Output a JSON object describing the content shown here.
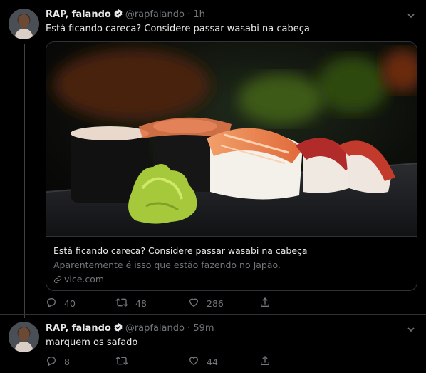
{
  "tweet1": {
    "name": "RAP, falando",
    "handle": "@rapfalando",
    "separator": "·",
    "time": "1h",
    "text": "Está ficando careca? Considere passar wasabi na cabeça",
    "card": {
      "title": "Está ficando careca? Considere passar wasabi na cabeça",
      "description": "Aparentemente é isso que estão fazendo no Japão.",
      "domain": "vice.com"
    },
    "replies": "40",
    "retweets": "48",
    "likes": "286"
  },
  "tweet2": {
    "name": "RAP, falando",
    "handle": "@rapfalando",
    "separator": "·",
    "time": "59m",
    "text": "marquem os safado",
    "replies": "8",
    "retweets": "",
    "likes": "44"
  },
  "colors": {
    "background": "#000000",
    "text_primary": "#e7e9ea",
    "text_secondary": "#71767b",
    "border": "#2f3336",
    "verified": "#e7e9ea"
  },
  "icons": [
    "verified-icon",
    "chevron-down-icon",
    "link-icon",
    "reply-icon",
    "retweet-icon",
    "like-icon",
    "share-icon"
  ]
}
